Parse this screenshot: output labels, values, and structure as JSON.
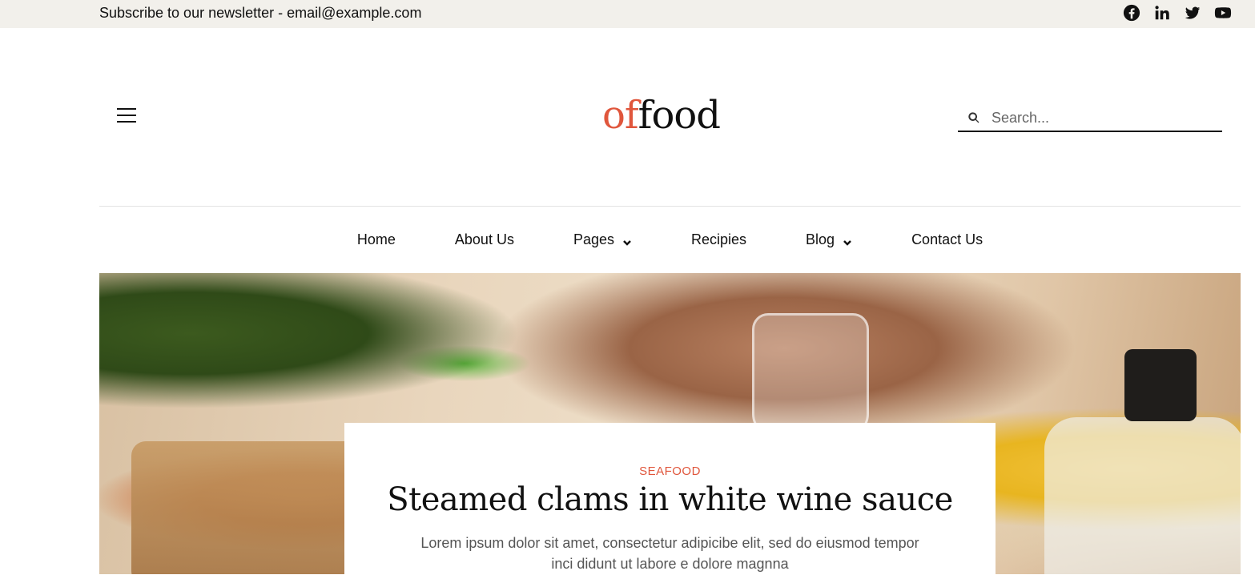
{
  "topbar": {
    "newsletter_text": "Subscribe to our newsletter - email@example.com",
    "social": [
      "facebook-icon",
      "linkedin-icon",
      "twitter-icon",
      "youtube-icon"
    ]
  },
  "header": {
    "logo_part1": "of",
    "logo_part2": "food",
    "logo_colors": {
      "accent": "#e0563c",
      "dark": "#111111"
    },
    "search_placeholder": "Search..."
  },
  "nav": {
    "items": [
      {
        "label": "Home",
        "has_dropdown": false
      },
      {
        "label": "About Us",
        "has_dropdown": false
      },
      {
        "label": "Pages",
        "has_dropdown": true
      },
      {
        "label": "Recipies",
        "has_dropdown": false
      },
      {
        "label": "Blog",
        "has_dropdown": true
      },
      {
        "label": "Contact Us",
        "has_dropdown": false
      }
    ]
  },
  "hero": {
    "category": "SEAFOOD",
    "title": "Steamed clams in white wine sauce",
    "excerpt": "Lorem ipsum dolor sit amet, consectetur adipicibe elit, sed do eiusmod tempor inci didunt ut labore e dolore magnna"
  }
}
